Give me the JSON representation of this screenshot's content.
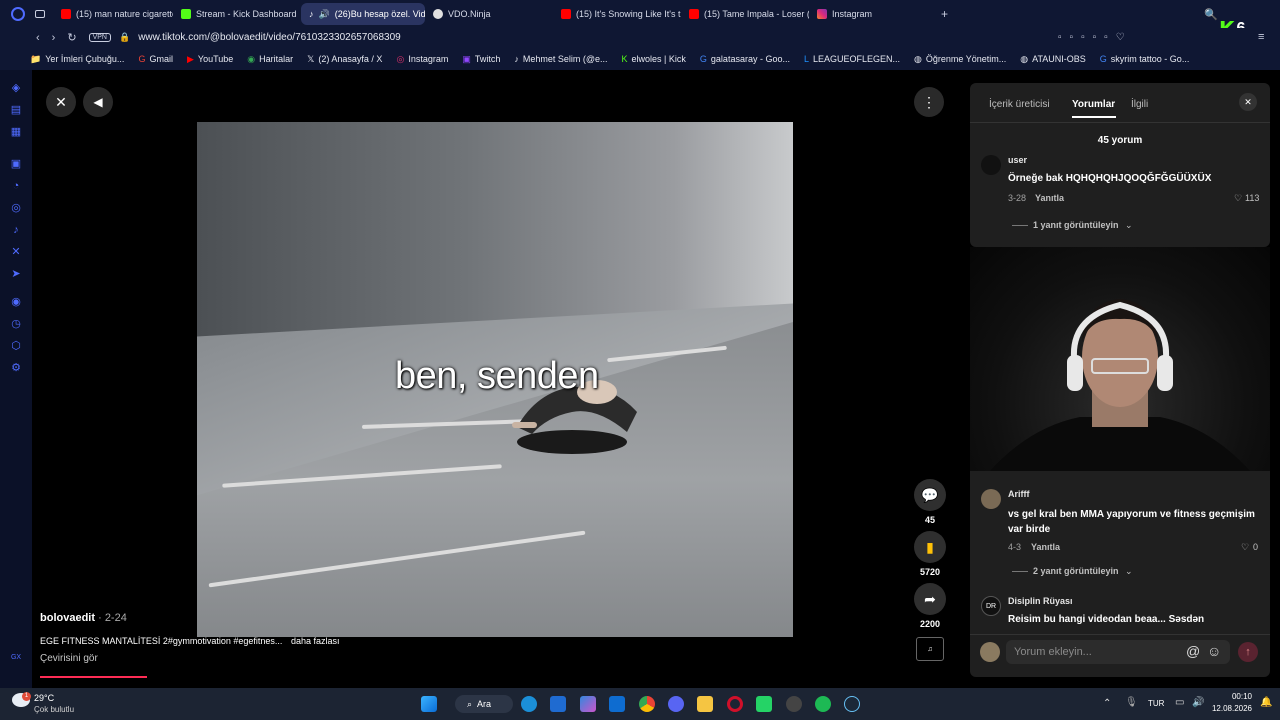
{
  "browser": {
    "tabs": [
      {
        "label": "(15) man nature cigarette s",
        "color": "#ff0000"
      },
      {
        "label": "Stream - Kick Dashboard",
        "color": "#53fc18"
      },
      {
        "label": "(26)Bu hesap özel. Vid",
        "color": "#ffffff",
        "active": true
      },
      {
        "label": "VDO.Ninja",
        "color": "#e0e0e0"
      },
      {
        "label": "(15) It's Snowing Like It's t",
        "color": "#ff0000"
      },
      {
        "label": "(15) Tame Impala - Loser (",
        "color": "#ff0000"
      },
      {
        "label": "Instagram",
        "color": "#e1306c"
      }
    ],
    "new_tab": "+",
    "vpn": "VPN",
    "url": "www.tiktok.com/@bolovaedit/video/7610323302657068309",
    "kick_badge": "6",
    "bookmarks": [
      "Yer İmleri Çubuğu...",
      "Gmail",
      "YouTube",
      "Haritalar",
      "(2) Anasayfa / X",
      "Instagram",
      "Twitch",
      "Mehmet Selim (@e...",
      "elwoles | Kick",
      "galatasaray - Goo...",
      "LEAGUEOFLEGEN...",
      "Öğrenme Yönetim...",
      "ATAUNI-OBS",
      "skyrim tattoo - Go..."
    ]
  },
  "video": {
    "overlay_text": "ben, senden",
    "author": "bolovaedit",
    "date": "2-24",
    "description": "EGE FITNESS MANTALİTESİ 2#gymmotivation #egefitnes...",
    "more": "daha fazlası",
    "translate": "Çevirisini gör",
    "comments_count": "45",
    "saves_count": "5720",
    "shares_count": "2200"
  },
  "panel": {
    "tabs": [
      "İçerik üreticisi",
      "Yorumlar",
      "İlgili"
    ],
    "total": "45 yorum",
    "comments": [
      {
        "user": "user",
        "text": "Örneğe bak HQHQHQHJQOQĞFĞGÜÜXÜX",
        "date": "3-28",
        "reply": "Yanıtla",
        "likes": "113",
        "replies": "1 yanıt görüntüleyin"
      },
      {
        "user": "Arifff",
        "text": "vs gel kral ben MMA yapıyorum ve fitness geçmişim var birde",
        "date": "4-3",
        "reply": "Yanıtla",
        "likes": "0",
        "replies": "2 yanıt görüntüleyin"
      },
      {
        "user": "Disiplin Rüyası",
        "text": "Reisim bu hangi videodan beaa... Səsdən"
      }
    ],
    "input_placeholder": "Yorum ekleyin..."
  },
  "taskbar": {
    "weather_temp": "29°C",
    "weather_desc": "Çok bulutlu",
    "search": "Ara",
    "lang": "TUR",
    "time": "00:10",
    "date": "12.08.2026",
    "weather_alert": "1"
  },
  "colors": {
    "browser_bg": "#0f1733",
    "accent_blue": "#4f6bff",
    "progress_red": "#fe2c55",
    "kick_green": "#53fc18"
  }
}
